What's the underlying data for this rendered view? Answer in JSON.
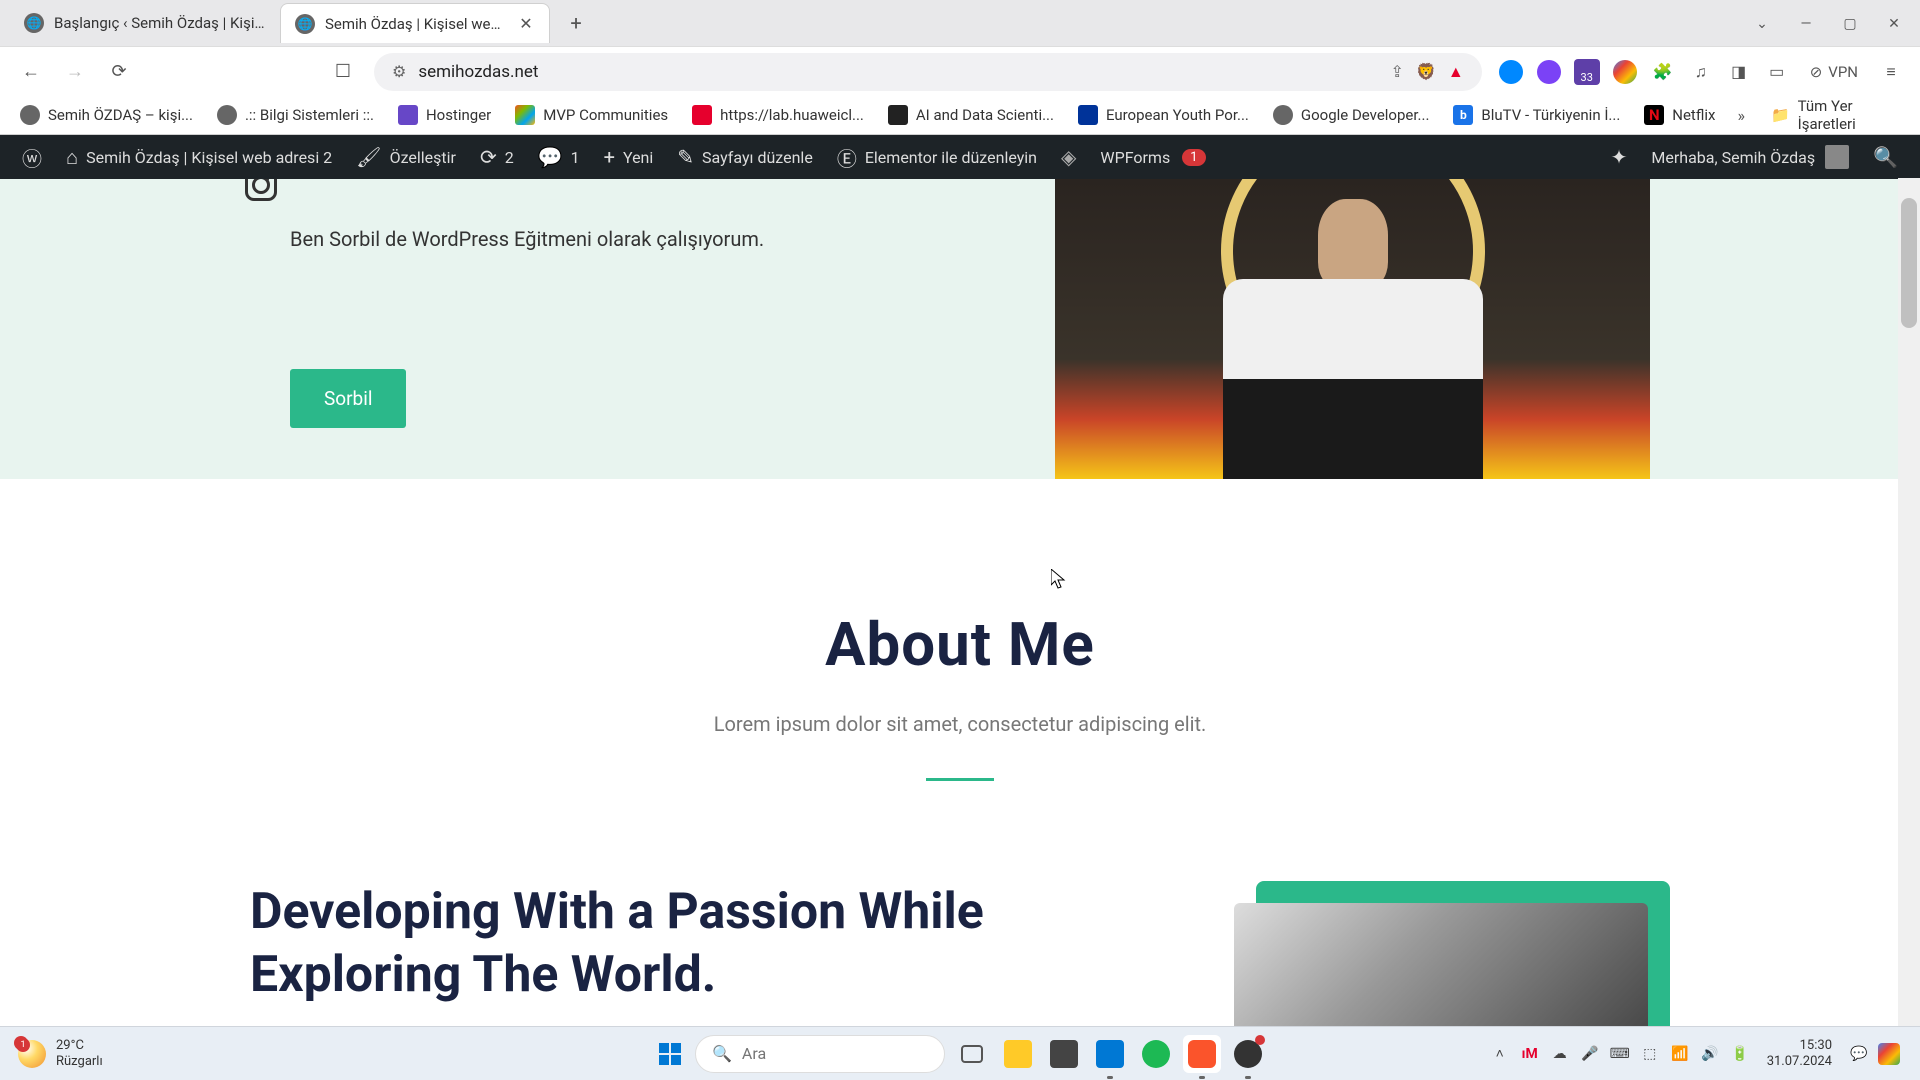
{
  "browser": {
    "tabs": [
      {
        "title": "Başlangıç ‹ Semih Özdaş | Kişisel we…",
        "active": false
      },
      {
        "title": "Semih Özdaş | Kişisel web adre",
        "active": true
      }
    ],
    "url_prefix": "",
    "url_domain": "semihozdas.net",
    "vpn_label": "VPN"
  },
  "bookmarks": [
    {
      "label": "Semih ÖZDAŞ – kişi...",
      "color": "#666"
    },
    {
      "label": ".:: Bilgi Sistemleri ::.",
      "color": "#666"
    },
    {
      "label": "Hostinger",
      "color": "#6747c7"
    },
    {
      "label": "MVP Communities",
      "color": "#00a4ef"
    },
    {
      "label": "https://lab.huaweicl...",
      "color": "#e6002d"
    },
    {
      "label": "AI and Data Scienti...",
      "color": "#333"
    },
    {
      "label": "European Youth Por...",
      "color": "#003399"
    },
    {
      "label": "Google Developer...",
      "color": "#666"
    },
    {
      "label": "BluTV - Türkiyenin İ...",
      "color": "#1a73e8"
    },
    {
      "label": "Netflix",
      "color": "#e50914"
    }
  ],
  "bookmarks_folder": "Tüm Yer İşaretleri",
  "wpbar": {
    "site_title": "Semih Özdaş | Kişisel web adresi 2",
    "customize": "Özelleştir",
    "updates": "2",
    "comments": "1",
    "new": "Yeni",
    "edit_page": "Sayfayı düzenle",
    "elementor": "Elementor ile düzenleyin",
    "wpforms": "WPForms",
    "wpforms_badge": "1",
    "greeting": "Merhaba, Semih Özdaş"
  },
  "hero": {
    "text": "Ben Sorbil de WordPress Eğitmeni olarak çalışıyorum.",
    "button": "Sorbil"
  },
  "about": {
    "title": "About Me",
    "subtitle": "Lorem ipsum dolor sit amet, consectetur adipiscing elit."
  },
  "dev": {
    "title": "Developing With a Passion While Exploring The World."
  },
  "taskbar": {
    "weather_badge": "1",
    "weather_temp": "29°C",
    "weather_cond": "Rüzgarlı",
    "search_placeholder": "Ara",
    "time": "15:30",
    "date": "31.07.2024"
  }
}
